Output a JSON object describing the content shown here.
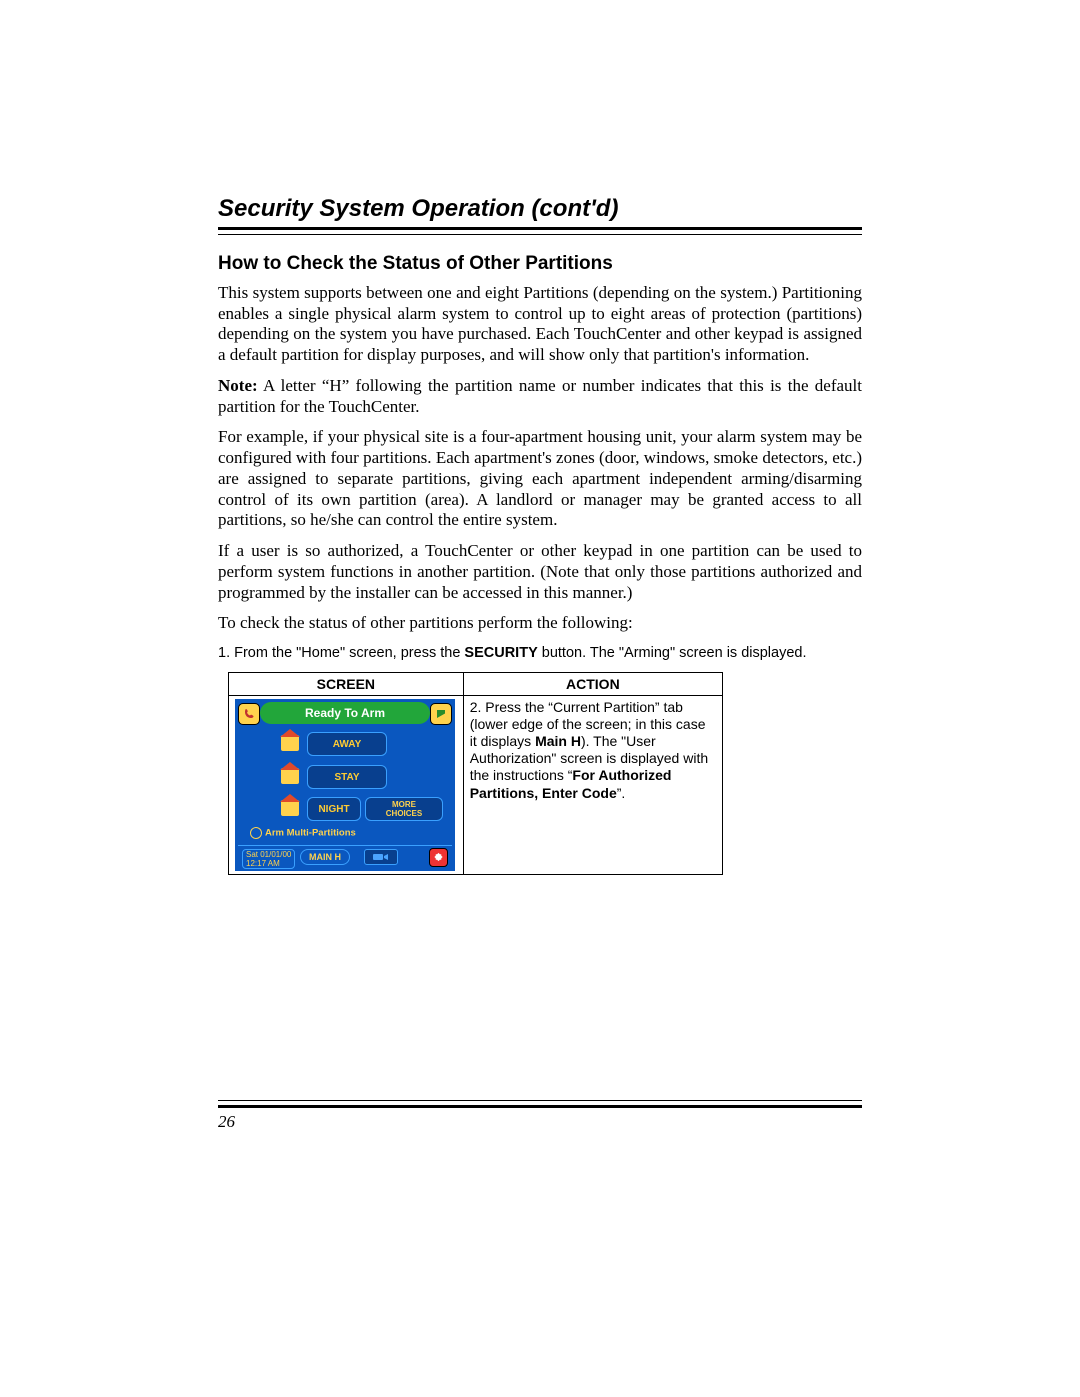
{
  "header": {
    "chapter_title": "Security System Operation (cont'd)",
    "section_title": "How to Check the Status of Other Partitions"
  },
  "body": {
    "p1": "This system supports between one and eight Partitions (depending on the system.)  Partitioning enables a single physical alarm system to control up to eight areas of protection (partitions) depending on the system you have purchased. Each TouchCenter and other keypad is assigned a default partition for display purposes, and will show only that partition's information.",
    "p2_label": "Note:",
    "p2_rest": " A letter “H” following the partition name or number indicates that this is the default partition for the TouchCenter.",
    "p3": "For example, if your physical site is a four-apartment housing unit, your alarm system may be configured with four partitions. Each apartment's zones (door, windows, smoke detectors, etc.) are assigned to separate partitions, giving each apartment independent arming/disarming control of its own partition (area).  A landlord or manager may be granted access to all partitions, so he/she can control the entire system.",
    "p4": "If a user is so authorized, a TouchCenter or other keypad in one partition can be used to perform system functions in another partition.  (Note that only those partitions authorized and programmed by the installer can be accessed in this manner.)",
    "p5": "To check the status of other partitions perform the following:"
  },
  "step1": {
    "pre": "1.  From the \"Home\" screen, press the ",
    "bold": "SECURITY",
    "post": " button.  The \"Arming\" screen is displayed."
  },
  "table": {
    "headers": {
      "col1": "SCREEN",
      "col2": "ACTION"
    },
    "action": {
      "line1": "2. Press the “Current Partition” tab (lower edge of the screen; in this case it displays ",
      "bold1": "Main H",
      "line2": ").  The \"User Authorization\" screen is displayed with the instructions “",
      "bold2": "For Authorized Partitions, Enter Code",
      "line3": "”."
    }
  },
  "touchcenter": {
    "status": "Ready To Arm",
    "buttons": {
      "away": "AWAY",
      "stay": "STAY",
      "night": "NIGHT"
    },
    "more_line1": "MORE",
    "more_line2": "CHOICES",
    "arm_multi": "Arm Multi-Partitions",
    "date_line1": "Sat 01/01/00",
    "date_line2": "12:17 AM",
    "partition_tab": "MAIN H"
  },
  "footer": {
    "page_number": "26"
  }
}
